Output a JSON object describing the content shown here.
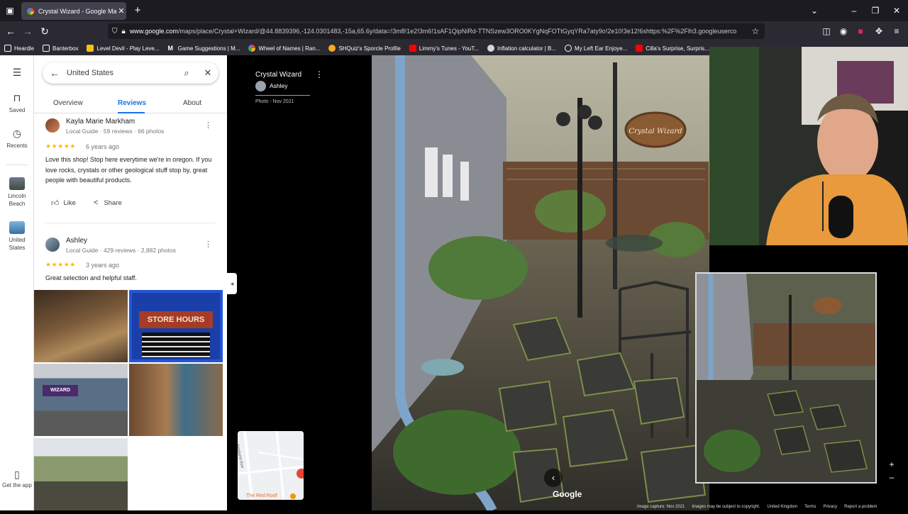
{
  "browser": {
    "tab_title": "Crystal Wizard - Google Maps",
    "url_host": "www.google.com",
    "url_path": "/maps/place/Crystal+Wizard/@44.8839396,-124.0301483,-15a,65.6y/data=!3m8!1e2!3m6!1sAF1QipNiRd-TTNSzew3ORO0KYgNqFOTtGyqYRa7aty9o!2e10!3e12!6shttps:%2F%2Flh3.googleuserco",
    "bookmarks": [
      "Heardle",
      "Banterbox",
      "Level Devil - Play Leve...",
      "Game Suggestions | M...",
      "Wheel of Names | Ran...",
      "SHQuiz's Sporcle Profile",
      "Limmy's Tunes - YouT...",
      "Inflation calculator | B...",
      "My Left Ear Enjoye...",
      "Cilla's Surprise, Surpris..."
    ]
  },
  "rail": {
    "saved": "Saved",
    "recents": "Recents",
    "recent1": "Lincoln Beach",
    "recent2": "United States",
    "get_app": "Get the app"
  },
  "panel": {
    "search_value": "United States",
    "tabs": [
      "Overview",
      "Reviews",
      "About"
    ],
    "reviews": [
      {
        "name": "Kayla Marie Markham",
        "meta": "Local Guide · 59 reviews · 66 photos",
        "stars": "★★★★★",
        "ago": "6 years ago",
        "text": "Love this shop! Stop here everytime we're in oregon. If you love rocks, crystals or other geological stuff stop by, great people with beautiful products.",
        "like": "Like",
        "share": "Share"
      },
      {
        "name": "Ashley",
        "meta": "Local Guide · 429 reviews · 2,882 photos",
        "stars": "★★★★★",
        "ago": "3 years ago",
        "text": "Great selection and helpful staff."
      }
    ],
    "photo_sign": "STORE HOURS",
    "photo_storefront_sign": "WIZARD"
  },
  "viewer": {
    "title": "Crystal Wizard",
    "author": "Ashley",
    "date": "Photo - Nov 2021",
    "sign_text": "Crystal Wizard",
    "minimap_street": "Neptune Ave",
    "minimap_place": "The Red Roof",
    "google": "Google",
    "footer": [
      "Image capture: Nov 2021",
      "Images may be subject to copyright.",
      "United Kingdom",
      "Terms",
      "Privacy",
      "Report a problem"
    ]
  }
}
